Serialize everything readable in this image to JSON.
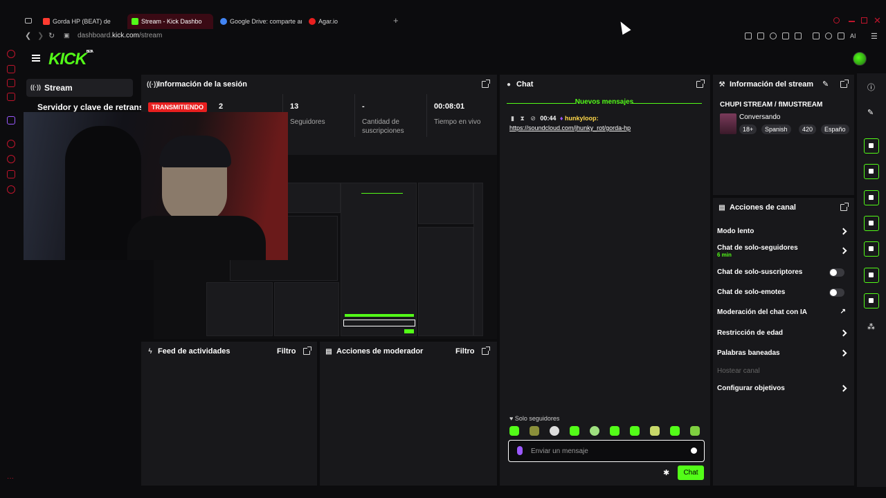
{
  "browser": {
    "tabs": [
      {
        "label": "Gorda HP (BEAT) de",
        "fav": "#ff3b30",
        "active": false
      },
      {
        "label": "Stream - Kick Dashbo",
        "fav": "#53fc18",
        "active": true
      },
      {
        "label": "Google Drive: comparte ar",
        "fav": "#4285f4",
        "active": false
      },
      {
        "label": "Agar.io",
        "fav": "#e81f1f",
        "active": false
      }
    ],
    "new_tab": "+",
    "url_prefix": "dashboard.",
    "url_domain": "kick.com",
    "url_path": "/stream",
    "ai_label": "AI"
  },
  "header": {
    "logo": "KICK",
    "logo_tag": "BETA"
  },
  "left_nav": {
    "stream_label": "Stream",
    "server_label": "Servidor y clave de retransm"
  },
  "session": {
    "title": "Información de la sesión",
    "live_badge": "TRANSMITIENDO",
    "viewers_value": "2",
    "followers_value": "13",
    "followers_label": "Seguidores",
    "subs_value": "-",
    "subs_label": "Cantidad de suscripciones",
    "time_value": "00:08:01",
    "time_label": "Tiempo en vivo"
  },
  "chat": {
    "title": "Chat",
    "new_messages": "Nuevos mensajes",
    "msg_time": "00:44",
    "msg_user": "hunkyloop:",
    "msg_link": "https://soundcloud.com/jhunky_rot/gorda-hp",
    "followers_only": "Solo seguidores",
    "input_placeholder": "Enviar un mensaje",
    "send_label": "Chat",
    "user_color": "#ffd84a"
  },
  "stream_info": {
    "title": "Información del stream",
    "stream_title": "CHUPI STREAM / fIMUSTREAM",
    "category": "Conversando",
    "tags": [
      "18+",
      "Spanish",
      "420",
      "Españo"
    ]
  },
  "channel_actions": {
    "title": "Acciones de canal",
    "items": [
      {
        "label": "Modo lento"
      },
      {
        "label": "Chat de solo-seguidores",
        "sub": "6 min"
      },
      {
        "label": "Chat de solo-suscriptores"
      },
      {
        "label": "Chat de solo-emotes"
      },
      {
        "label": "Moderación del chat con IA"
      },
      {
        "label": "Restricción de edad"
      },
      {
        "label": "Palabras baneadas"
      },
      {
        "label": "Hostear canal"
      },
      {
        "label": "Configurar objetivos"
      }
    ]
  },
  "activity": {
    "title": "Feed de actividades",
    "filter": "Filtro"
  },
  "mod_actions": {
    "title": "Acciones de moderador",
    "filter": "Filtro"
  },
  "colors": {
    "accent": "#53fc18",
    "live": "#e81f1f",
    "panel": "#18181b",
    "page": "#0c0c0e"
  }
}
